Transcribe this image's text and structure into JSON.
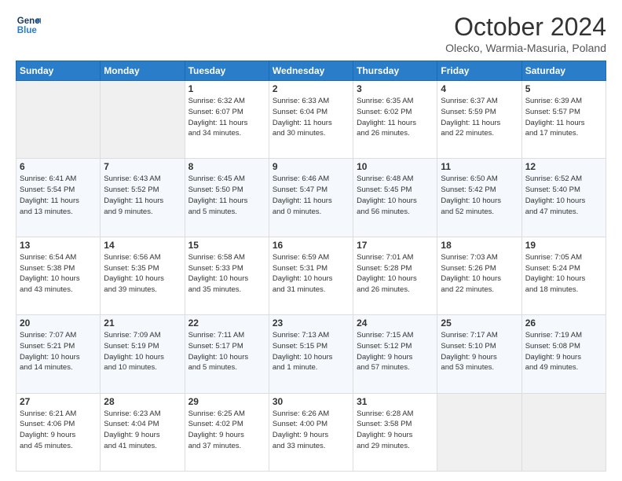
{
  "header": {
    "logo_line1": "General",
    "logo_line2": "Blue",
    "month": "October 2024",
    "location": "Olecko, Warmia-Masuria, Poland"
  },
  "weekdays": [
    "Sunday",
    "Monday",
    "Tuesday",
    "Wednesday",
    "Thursday",
    "Friday",
    "Saturday"
  ],
  "weeks": [
    [
      {
        "day": "",
        "info": ""
      },
      {
        "day": "",
        "info": ""
      },
      {
        "day": "1",
        "info": "Sunrise: 6:32 AM\nSunset: 6:07 PM\nDaylight: 11 hours\nand 34 minutes."
      },
      {
        "day": "2",
        "info": "Sunrise: 6:33 AM\nSunset: 6:04 PM\nDaylight: 11 hours\nand 30 minutes."
      },
      {
        "day": "3",
        "info": "Sunrise: 6:35 AM\nSunset: 6:02 PM\nDaylight: 11 hours\nand 26 minutes."
      },
      {
        "day": "4",
        "info": "Sunrise: 6:37 AM\nSunset: 5:59 PM\nDaylight: 11 hours\nand 22 minutes."
      },
      {
        "day": "5",
        "info": "Sunrise: 6:39 AM\nSunset: 5:57 PM\nDaylight: 11 hours\nand 17 minutes."
      }
    ],
    [
      {
        "day": "6",
        "info": "Sunrise: 6:41 AM\nSunset: 5:54 PM\nDaylight: 11 hours\nand 13 minutes."
      },
      {
        "day": "7",
        "info": "Sunrise: 6:43 AM\nSunset: 5:52 PM\nDaylight: 11 hours\nand 9 minutes."
      },
      {
        "day": "8",
        "info": "Sunrise: 6:45 AM\nSunset: 5:50 PM\nDaylight: 11 hours\nand 5 minutes."
      },
      {
        "day": "9",
        "info": "Sunrise: 6:46 AM\nSunset: 5:47 PM\nDaylight: 11 hours\nand 0 minutes."
      },
      {
        "day": "10",
        "info": "Sunrise: 6:48 AM\nSunset: 5:45 PM\nDaylight: 10 hours\nand 56 minutes."
      },
      {
        "day": "11",
        "info": "Sunrise: 6:50 AM\nSunset: 5:42 PM\nDaylight: 10 hours\nand 52 minutes."
      },
      {
        "day": "12",
        "info": "Sunrise: 6:52 AM\nSunset: 5:40 PM\nDaylight: 10 hours\nand 47 minutes."
      }
    ],
    [
      {
        "day": "13",
        "info": "Sunrise: 6:54 AM\nSunset: 5:38 PM\nDaylight: 10 hours\nand 43 minutes."
      },
      {
        "day": "14",
        "info": "Sunrise: 6:56 AM\nSunset: 5:35 PM\nDaylight: 10 hours\nand 39 minutes."
      },
      {
        "day": "15",
        "info": "Sunrise: 6:58 AM\nSunset: 5:33 PM\nDaylight: 10 hours\nand 35 minutes."
      },
      {
        "day": "16",
        "info": "Sunrise: 6:59 AM\nSunset: 5:31 PM\nDaylight: 10 hours\nand 31 minutes."
      },
      {
        "day": "17",
        "info": "Sunrise: 7:01 AM\nSunset: 5:28 PM\nDaylight: 10 hours\nand 26 minutes."
      },
      {
        "day": "18",
        "info": "Sunrise: 7:03 AM\nSunset: 5:26 PM\nDaylight: 10 hours\nand 22 minutes."
      },
      {
        "day": "19",
        "info": "Sunrise: 7:05 AM\nSunset: 5:24 PM\nDaylight: 10 hours\nand 18 minutes."
      }
    ],
    [
      {
        "day": "20",
        "info": "Sunrise: 7:07 AM\nSunset: 5:21 PM\nDaylight: 10 hours\nand 14 minutes."
      },
      {
        "day": "21",
        "info": "Sunrise: 7:09 AM\nSunset: 5:19 PM\nDaylight: 10 hours\nand 10 minutes."
      },
      {
        "day": "22",
        "info": "Sunrise: 7:11 AM\nSunset: 5:17 PM\nDaylight: 10 hours\nand 5 minutes."
      },
      {
        "day": "23",
        "info": "Sunrise: 7:13 AM\nSunset: 5:15 PM\nDaylight: 10 hours\nand 1 minute."
      },
      {
        "day": "24",
        "info": "Sunrise: 7:15 AM\nSunset: 5:12 PM\nDaylight: 9 hours\nand 57 minutes."
      },
      {
        "day": "25",
        "info": "Sunrise: 7:17 AM\nSunset: 5:10 PM\nDaylight: 9 hours\nand 53 minutes."
      },
      {
        "day": "26",
        "info": "Sunrise: 7:19 AM\nSunset: 5:08 PM\nDaylight: 9 hours\nand 49 minutes."
      }
    ],
    [
      {
        "day": "27",
        "info": "Sunrise: 6:21 AM\nSunset: 4:06 PM\nDaylight: 9 hours\nand 45 minutes."
      },
      {
        "day": "28",
        "info": "Sunrise: 6:23 AM\nSunset: 4:04 PM\nDaylight: 9 hours\nand 41 minutes."
      },
      {
        "day": "29",
        "info": "Sunrise: 6:25 AM\nSunset: 4:02 PM\nDaylight: 9 hours\nand 37 minutes."
      },
      {
        "day": "30",
        "info": "Sunrise: 6:26 AM\nSunset: 4:00 PM\nDaylight: 9 hours\nand 33 minutes."
      },
      {
        "day": "31",
        "info": "Sunrise: 6:28 AM\nSunset: 3:58 PM\nDaylight: 9 hours\nand 29 minutes."
      },
      {
        "day": "",
        "info": ""
      },
      {
        "day": "",
        "info": ""
      }
    ]
  ]
}
